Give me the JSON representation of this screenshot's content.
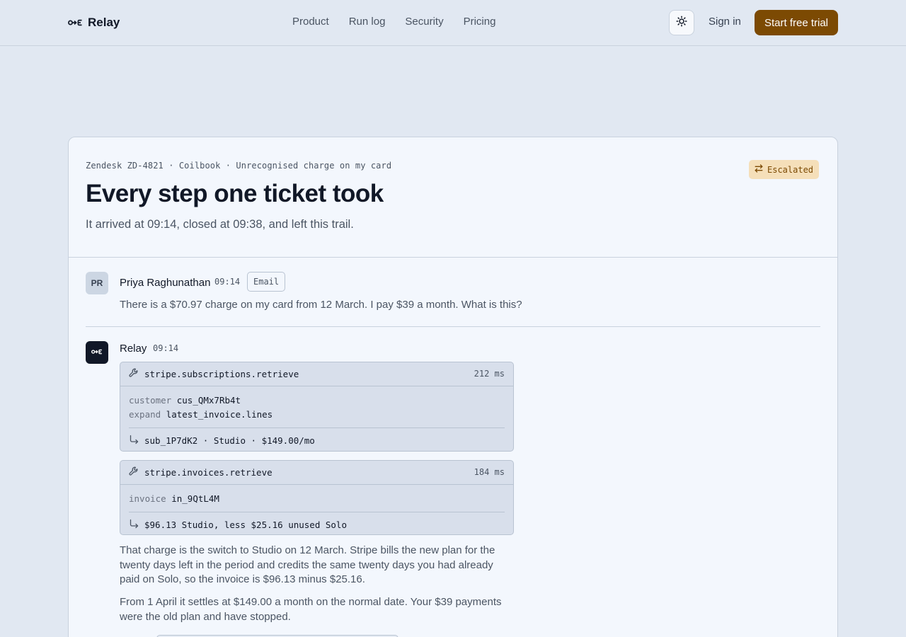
{
  "nav": {
    "brand": "Relay",
    "links": [
      "Product",
      "Run log",
      "Security",
      "Pricing"
    ],
    "sign_in": "Sign in",
    "cta": "Start free trial",
    "theme_icon": "sun-icon",
    "brand_icon": "relay-logo-icon"
  },
  "ticket": {
    "meta": "Zendesk ZD-4821 · Coilbook · Unrecognised charge on my card",
    "status": "Escalated",
    "status_icon": "swap-arrows-icon",
    "title": "Every step one ticket took",
    "subtitle": "It arrived at 09:14, closed at 09:38, and left this trail."
  },
  "messages": [
    {
      "avatar": "PR",
      "sender": "Priya Raghunathan",
      "time": "09:14",
      "channel": "Email",
      "text": "There is a $70.97 charge on my card from 12 March. I pay $39 a month. What is this?"
    },
    {
      "sender": "Relay",
      "time": "09:14",
      "tools": [
        {
          "name": "stripe.subscriptions.retrieve",
          "duration": "212 ms",
          "args": [
            {
              "key": "customer",
              "value": "cus_QMx7Rb4t"
            },
            {
              "key": "expand",
              "value": "latest_invoice.lines"
            }
          ],
          "result": "sub_1P7dK2 · Studio · $149.00/mo"
        },
        {
          "name": "stripe.invoices.retrieve",
          "duration": "184 ms",
          "args": [
            {
              "key": "invoice",
              "value": "in_9QtL4M"
            }
          ],
          "result": "$96.13 Studio, less $25.16 unused Solo"
        }
      ],
      "paragraphs": [
        "That charge is the switch to Studio on 12 March. Stripe bills the new plan for the twenty days left in the period and credits the same twenty days you had already paid on Solo, so the invoice is $96.13 minus $25.16.",
        "From 1 April it settles at $149.00 a month on the normal date. Your $39 payments were the old plan and have stopped."
      ]
    }
  ],
  "colors": {
    "page_bg": "#e1e8f2",
    "card_bg": "#f3f7fd",
    "accent": "#7c4a03",
    "escalated_bg": "#f5dfb9",
    "tool_bg": "#d8dfeb"
  }
}
